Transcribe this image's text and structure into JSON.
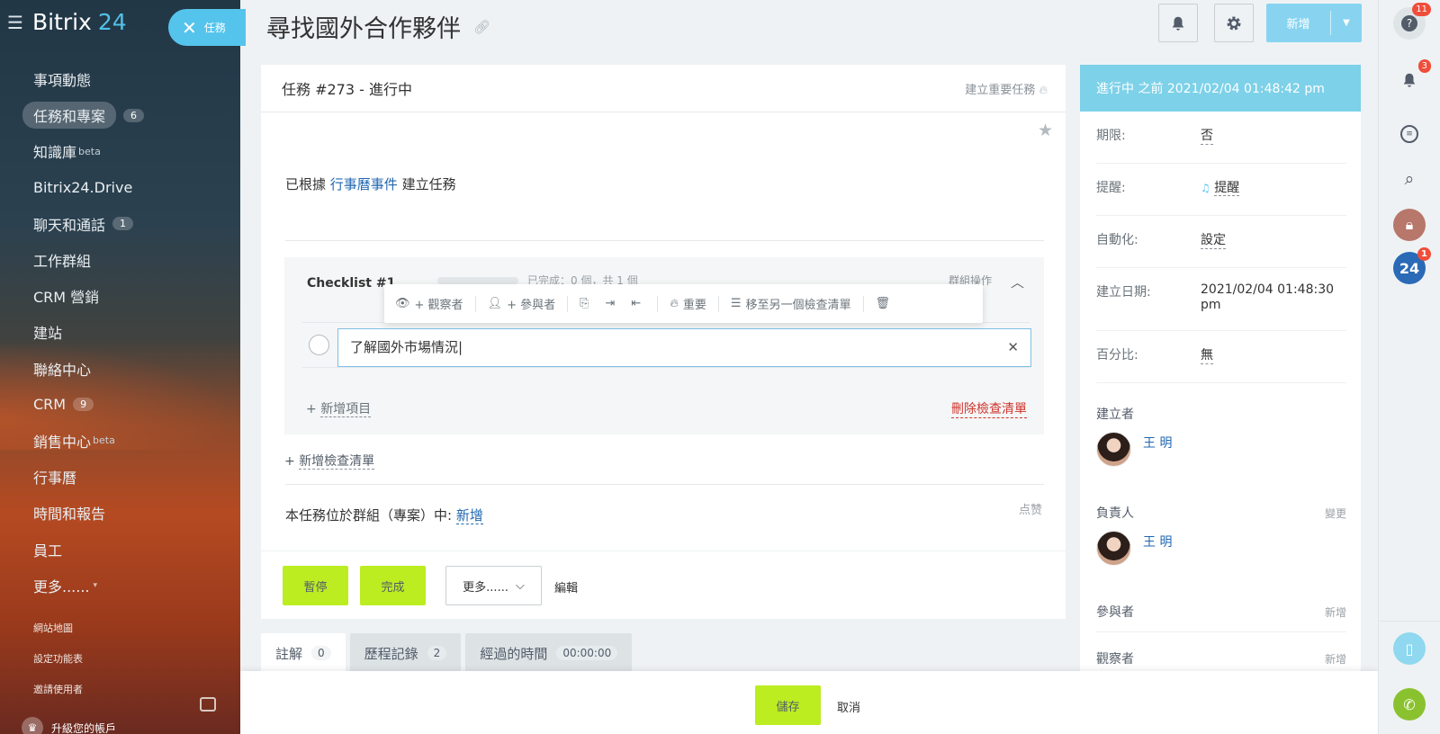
{
  "app": {
    "brand_a": "Bitrix",
    "brand_b": "24"
  },
  "sidebar": {
    "items": [
      {
        "label": "事項動態"
      },
      {
        "label": "任務和專案",
        "badge": "6",
        "active": true
      },
      {
        "label": "知識庫",
        "sup": "beta"
      },
      {
        "label": "Bitrix24.Drive"
      },
      {
        "label": "聊天和通話",
        "badge": "1"
      },
      {
        "label": "工作群組"
      },
      {
        "label": "CRM 營銷"
      },
      {
        "label": "建站"
      },
      {
        "label": "聯絡中心"
      },
      {
        "label": "CRM",
        "badge": "9"
      },
      {
        "label": "銷售中心",
        "sup": "beta"
      },
      {
        "label": "行事曆"
      },
      {
        "label": "時間和報告"
      },
      {
        "label": "員工"
      },
      {
        "label": "更多......"
      }
    ],
    "links": [
      "網站地圖",
      "設定功能表",
      "邀請使用者"
    ],
    "upgrade": "升級您的帳戶"
  },
  "task_pill": "任務",
  "header": {
    "title": "尋找國外合作夥伴",
    "add": "新增"
  },
  "card": {
    "title": "任務 #273 - 進行中",
    "important": "建立重要任務",
    "desc_pre": "已根據",
    "desc_link": "行事曆事件",
    "desc_post": "建立任務",
    "checklist": {
      "title": "Checklist #1",
      "progress": "已完成：0 個，共 1 個",
      "group_ops": "群組操作",
      "toolbar": {
        "observer": "+ 觀察者",
        "participant": "+ 參與者",
        "important": "重要",
        "move": "移至另一個檢查清單"
      },
      "item_value": "了解國外市場情況",
      "add_item": "新增項目",
      "delete": "刪除檢查清單"
    },
    "add_checklist": "新增檢查清單",
    "group_text": "本任務位於群組（專案）中:",
    "group_link": "新增",
    "like": "点赞",
    "btn_pause": "暫停",
    "btn_done": "完成",
    "btn_more": "更多......",
    "btn_edit": "編輯"
  },
  "tabs": [
    {
      "label": "註解",
      "count": "0"
    },
    {
      "label": "歷程記錄",
      "count": "2"
    },
    {
      "label": "經過的時間",
      "count": "00:00:00"
    }
  ],
  "bottom": {
    "save": "儲存",
    "cancel": "取消"
  },
  "side": {
    "status": "進行中 之前 2021/02/04 01:48:42 pm",
    "rows": [
      {
        "k": "期限:",
        "v": "否"
      },
      {
        "k": "提醒:",
        "v": "提醒"
      },
      {
        "k": "自動化:",
        "v": "設定"
      },
      {
        "k": "建立日期:",
        "v": "2021/02/04 01:48:30 pm"
      },
      {
        "k": "百分比:",
        "v": "無"
      }
    ],
    "creator": "建立者",
    "creator_name": "王 明",
    "responsible": "負責人",
    "change": "變更",
    "responsible_name": "王 明",
    "participants": "參與者",
    "participants_add": "新增",
    "observers": "觀察者",
    "observers_add": "新增"
  },
  "rail": {
    "help_badge": "11",
    "notif_badge": "3",
    "b24_badge": "1",
    "b24": "24"
  },
  "colors": {
    "accent": "#55c4ec",
    "green": "#bbed21",
    "link": "#2067b0",
    "danger": "#d0342c"
  }
}
